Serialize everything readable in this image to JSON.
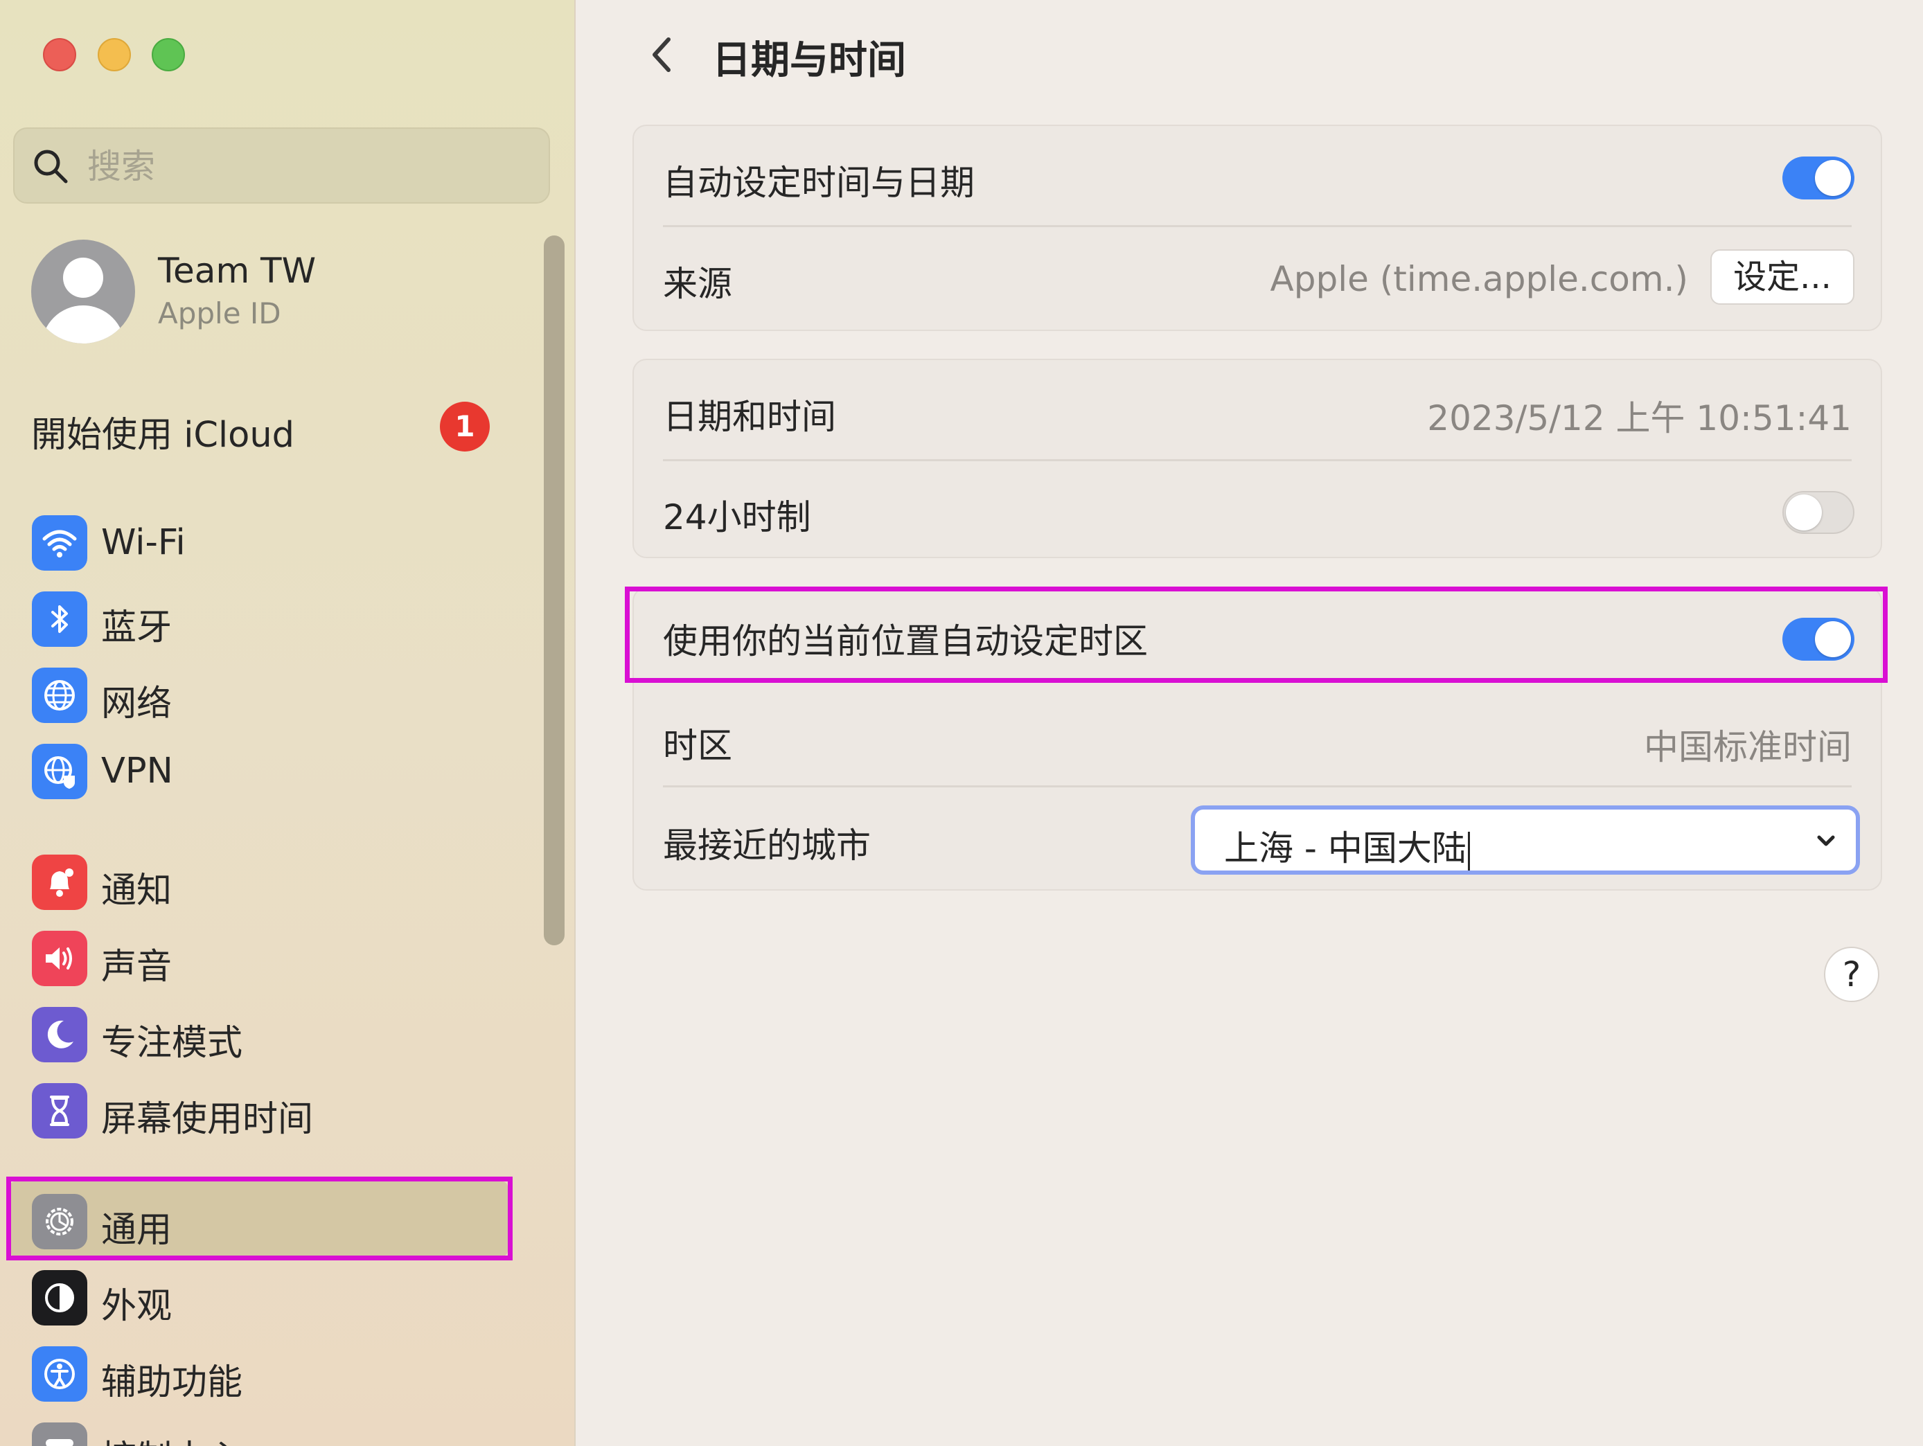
{
  "sidebar": {
    "search": {
      "placeholder": "搜索"
    },
    "account": {
      "name": "Team TW",
      "subtitle": "Apple ID"
    },
    "icloud": {
      "label": "開始使用 iCloud",
      "badge": "1"
    },
    "items": [
      {
        "label": "Wi-Fi",
        "icon": "wifi-icon",
        "color": "#3b82f6"
      },
      {
        "label": "蓝牙",
        "icon": "bluetooth-icon",
        "color": "#3b82f6"
      },
      {
        "label": "网络",
        "icon": "globe-icon",
        "color": "#3b82f6"
      },
      {
        "label": "VPN",
        "icon": "vpn-globe-icon",
        "color": "#3b82f6"
      },
      {
        "label": "通知",
        "icon": "bell-icon",
        "color": "#ef4444"
      },
      {
        "label": "声音",
        "icon": "speaker-icon",
        "color": "#ef4459"
      },
      {
        "label": "专注模式",
        "icon": "moon-icon",
        "color": "#6d5bd0"
      },
      {
        "label": "屏幕使用时间",
        "icon": "hourglass-icon",
        "color": "#6d5bd0"
      },
      {
        "label": "通用",
        "icon": "gear-icon",
        "color": "#8e8e93",
        "selected": true
      },
      {
        "label": "外观",
        "icon": "appearance-icon",
        "color": "#1c1c1e"
      },
      {
        "label": "辅助功能",
        "icon": "accessibility-icon",
        "color": "#3b82f6"
      },
      {
        "label": "控制中心",
        "icon": "control-center-icon",
        "color": "#8e8e93"
      }
    ]
  },
  "header": {
    "title": "日期与时间",
    "back_icon": "chevron-left-icon"
  },
  "settings": {
    "auto_time": {
      "label": "自动设定时间与日期",
      "enabled": true
    },
    "source": {
      "label": "来源",
      "value": "Apple (time.apple.com.)",
      "button": "设定..."
    },
    "date_time": {
      "label": "日期和时间",
      "value": "2023/5/12 上午 10:51:41"
    },
    "hour24": {
      "label": "24小时制",
      "enabled": false
    },
    "auto_timezone": {
      "label": "使用你的当前位置自动设定时区",
      "enabled": true
    },
    "timezone": {
      "label": "时区",
      "value": "中国标准时间"
    },
    "nearest_city": {
      "label": "最接近的城市",
      "value": "上海 - 中国大陆"
    }
  },
  "help": {
    "label": "?"
  },
  "colors": {
    "accent": "#3b82f6",
    "highlight": "#d90fd3"
  }
}
